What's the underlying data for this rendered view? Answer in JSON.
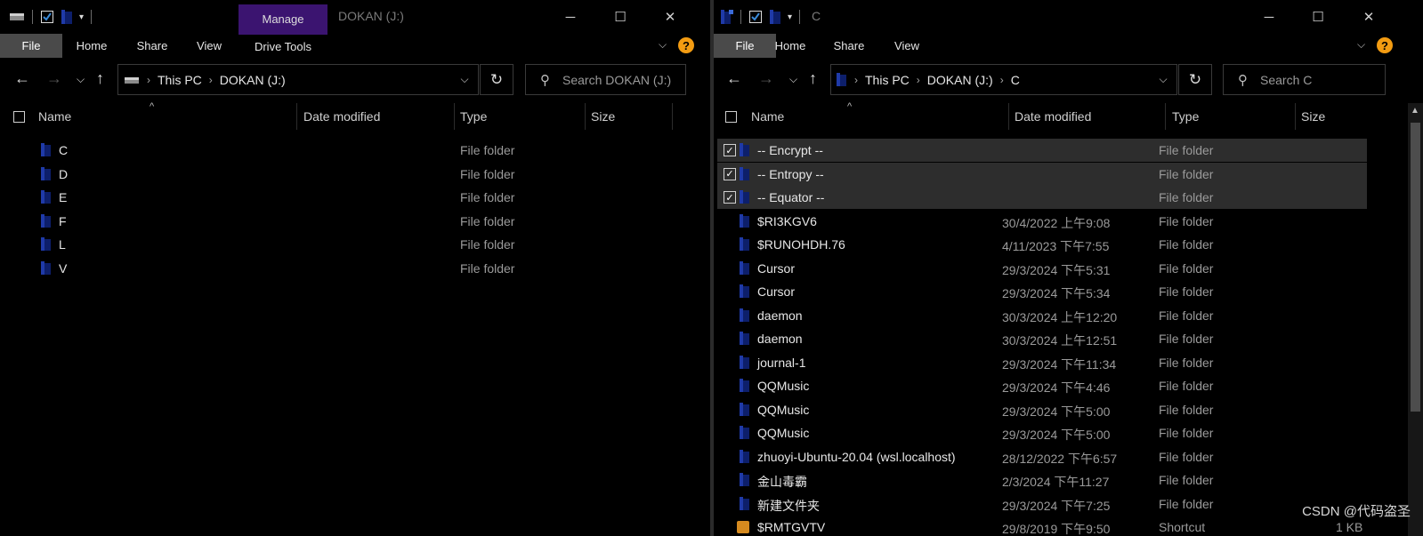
{
  "left": {
    "title": "DOKAN (J:)",
    "manage_label": "Manage",
    "tabs": [
      "File",
      "Home",
      "Share",
      "View",
      "Drive Tools"
    ],
    "breadcrumb": [
      "This PC",
      "DOKAN (J:)"
    ],
    "search_placeholder": "Search DOKAN (J:)",
    "columns": [
      "Name",
      "Date modified",
      "Type",
      "Size"
    ],
    "rows": [
      {
        "name": "C",
        "type": "File folder"
      },
      {
        "name": "D",
        "type": "File folder"
      },
      {
        "name": "E",
        "type": "File folder"
      },
      {
        "name": "F",
        "type": "File folder"
      },
      {
        "name": "L",
        "type": "File folder"
      },
      {
        "name": "V",
        "type": "File folder"
      }
    ]
  },
  "right": {
    "title": "C",
    "tabs": [
      "File",
      "Home",
      "Share",
      "View"
    ],
    "breadcrumb": [
      "This PC",
      "DOKAN (J:)",
      "C"
    ],
    "search_placeholder": "Search C",
    "columns": [
      "Name",
      "Date modified",
      "Type",
      "Size"
    ],
    "rows": [
      {
        "name": "-- Encrypt --",
        "date": "",
        "type": "File folder",
        "size": "",
        "selected": true
      },
      {
        "name": "-- Entropy --",
        "date": "",
        "type": "File folder",
        "size": "",
        "selected": true
      },
      {
        "name": "-- Equator --",
        "date": "",
        "type": "File folder",
        "size": "",
        "selected": true
      },
      {
        "name": "$RI3KGV6",
        "date": "30/4/2022 上午9:08",
        "type": "File folder",
        "size": ""
      },
      {
        "name": "$RUNOHDH.76",
        "date": "4/11/2023 下午7:55",
        "type": "File folder",
        "size": ""
      },
      {
        "name": "Cursor",
        "date": "29/3/2024 下午5:31",
        "type": "File folder",
        "size": ""
      },
      {
        "name": "Cursor",
        "date": "29/3/2024 下午5:34",
        "type": "File folder",
        "size": ""
      },
      {
        "name": "daemon",
        "date": "30/3/2024 上午12:20",
        "type": "File folder",
        "size": ""
      },
      {
        "name": "daemon",
        "date": "30/3/2024 上午12:51",
        "type": "File folder",
        "size": ""
      },
      {
        "name": "journal-1",
        "date": "29/3/2024 下午11:34",
        "type": "File folder",
        "size": ""
      },
      {
        "name": "QQMusic",
        "date": "29/3/2024 下午4:46",
        "type": "File folder",
        "size": ""
      },
      {
        "name": "QQMusic",
        "date": "29/3/2024 下午5:00",
        "type": "File folder",
        "size": ""
      },
      {
        "name": "QQMusic",
        "date": "29/3/2024 下午5:00",
        "type": "File folder",
        "size": ""
      },
      {
        "name": "zhuoyi-Ubuntu-20.04 (wsl.localhost)",
        "date": "28/12/2022 下午6:57",
        "type": "File folder",
        "size": ""
      },
      {
        "name": "金山毒霸",
        "date": "2/3/2024 下午11:27",
        "type": "File folder",
        "size": ""
      },
      {
        "name": "新建文件夹",
        "date": "29/3/2024 下午7:25",
        "type": "File folder",
        "size": ""
      },
      {
        "name": "$RMTGVTV",
        "date": "29/8/2019 下午9:50",
        "type": "Shortcut",
        "size": "1 KB",
        "shortcut": true
      }
    ]
  },
  "watermark": "CSDN @代码盗圣",
  "colors": {
    "manage_bg": "#3b1470",
    "help_bg": "#f39c12",
    "folder_blue": "#1f3aa8",
    "selected_row_bg": "#2d2d2d"
  }
}
